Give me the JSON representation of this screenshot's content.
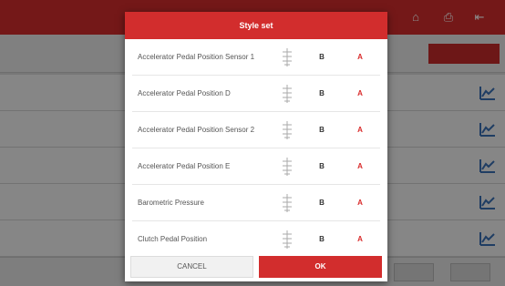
{
  "dialog": {
    "title": "Style set",
    "items": [
      {
        "name": "Accelerator Pedal Position Sensor 1",
        "option_b": "B",
        "option_a": "A"
      },
      {
        "name": "Accelerator Pedal Position D",
        "option_b": "B",
        "option_a": "A"
      },
      {
        "name": "Accelerator Pedal Position Sensor 2",
        "option_b": "B",
        "option_a": "A"
      },
      {
        "name": "Accelerator Pedal Position E",
        "option_b": "B",
        "option_a": "A"
      },
      {
        "name": "Barometric Pressure",
        "option_b": "B",
        "option_a": "A"
      },
      {
        "name": "Clutch Pedal Position",
        "option_b": "B",
        "option_a": "A"
      }
    ],
    "cancel_label": "CANCEL",
    "ok_label": "OK"
  },
  "colors": {
    "accent": "#d22d2d",
    "selected_option": "#d92a2a",
    "dim_overlay": "rgba(0,0,0,0.45)"
  },
  "icons": {
    "style_item": "style-icon",
    "graph": "graph-icon"
  }
}
